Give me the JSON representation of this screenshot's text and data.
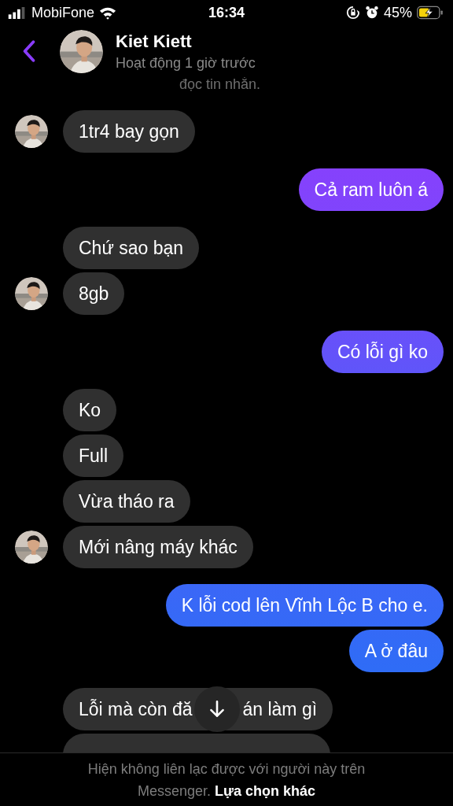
{
  "status_bar": {
    "carrier": "MobiFone",
    "time": "16:34",
    "battery": "45%",
    "charging": true
  },
  "header": {
    "name": "Kiet Kiett",
    "status": "Hoạt động 1 giờ trước",
    "overflow_line": "đọc tin nhắn."
  },
  "groups": [
    {
      "kind": "incoming",
      "messages": [
        {
          "kind": "text",
          "text": "1tr4 bay gọn"
        }
      ]
    },
    {
      "kind": "outgoing",
      "messages": [
        {
          "kind": "text",
          "text": "Cả ram luôn á"
        }
      ]
    },
    {
      "kind": "incoming",
      "messages": [
        {
          "kind": "text",
          "text": "Chứ sao bạn"
        },
        {
          "kind": "text",
          "text": "8gb"
        }
      ]
    },
    {
      "kind": "outgoing",
      "messages": [
        {
          "kind": "text",
          "text": "Có lỗi gì ko"
        }
      ]
    },
    {
      "kind": "incoming",
      "messages": [
        {
          "kind": "text",
          "text": "Ko"
        },
        {
          "kind": "text",
          "text": "Full"
        },
        {
          "kind": "text",
          "text": "Vừa tháo ra"
        },
        {
          "kind": "text",
          "text": "Mới nâng máy khác"
        }
      ]
    },
    {
      "kind": "outgoing",
      "messages": [
        {
          "kind": "text",
          "text": "K lỗi cod lên Vĩnh Lộc B cho e."
        },
        {
          "kind": "text",
          "text": "A ở đâu"
        }
      ]
    },
    {
      "kind": "incoming",
      "messages": [
        {
          "kind": "covered",
          "parts": [
            "Lỗi mà còn đă",
            "án làm gì"
          ]
        },
        {
          "kind": "cut"
        }
      ]
    }
  ],
  "footer": {
    "notice": "Hiện không liên lạc được với người này trên Messenger.",
    "link": "Lựa chọn khác"
  }
}
